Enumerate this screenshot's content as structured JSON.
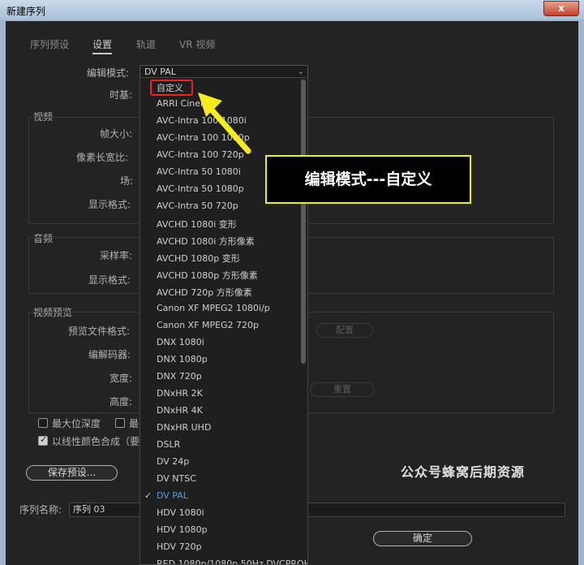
{
  "window": {
    "title": "新建序列",
    "close": "x"
  },
  "tabs": [
    {
      "label": "序列预设"
    },
    {
      "label": "设置"
    },
    {
      "label": "轨道"
    },
    {
      "label": "VR 视频"
    }
  ],
  "settings": {
    "edit_mode_label": "编辑模式:",
    "edit_mode_value": "DV PAL",
    "timebase_label": "时基:",
    "video_section": "视频",
    "frame_size_label": "帧大小:",
    "pixel_aspect_label": "像素长宽比:",
    "field_label": "场:",
    "display_format_label": "显示格式:",
    "audio_section": "音频",
    "sample_rate_label": "采样率:",
    "audio_display_label": "显示格式:",
    "preview_section": "视频预览",
    "preview_format_label": "预览文件格式:",
    "codec_label": "编解码器:",
    "width_label": "宽度:",
    "height_label": "高度:",
    "config_button": "配置",
    "reset_button": "重置",
    "max_depth_label": "最大位深度",
    "max_quality_label": "最",
    "linear_color_label": "以线性颜色合成（要"
  },
  "footer": {
    "save_preset": "保存预设...",
    "sequence_name_label": "序列名称:",
    "sequence_name_value": "序列 03",
    "ok_button": "确定"
  },
  "dropdown": {
    "items": [
      "自定义",
      "ARRI Cinema",
      "AVC-Intra 100 1080i",
      "AVC-Intra 100 1080p",
      "AVC-Intra 100 720p",
      "AVC-Intra 50 1080i",
      "AVC-Intra 50 1080p",
      "AVC-Intra 50 720p",
      "AVCHD 1080i 变形",
      "AVCHD 1080i 方形像素",
      "AVCHD 1080p 变形",
      "AVCHD 1080p 方形像素",
      "AVCHD 720p 方形像素",
      "Canon XF MPEG2 1080i/p",
      "Canon XF MPEG2 720p",
      "DNX 1080i",
      "DNX 1080p",
      "DNX 720p",
      "DNxHR 2K",
      "DNxHR 4K",
      "DNxHR UHD",
      "DSLR",
      "DV 24p",
      "DV NTSC",
      "DV PAL",
      "HDV 1080i",
      "HDV 1080p",
      "HDV 720p",
      "RED 1080p/1080p 50Hz DVCPROHD"
    ],
    "selected": "DV PAL"
  },
  "annotation": {
    "callout": "编辑模式---自定义",
    "watermark": "公众号蜂窝后期资源",
    "arrow_color": "#f4ec1c",
    "highlight_color": "#e22222"
  }
}
